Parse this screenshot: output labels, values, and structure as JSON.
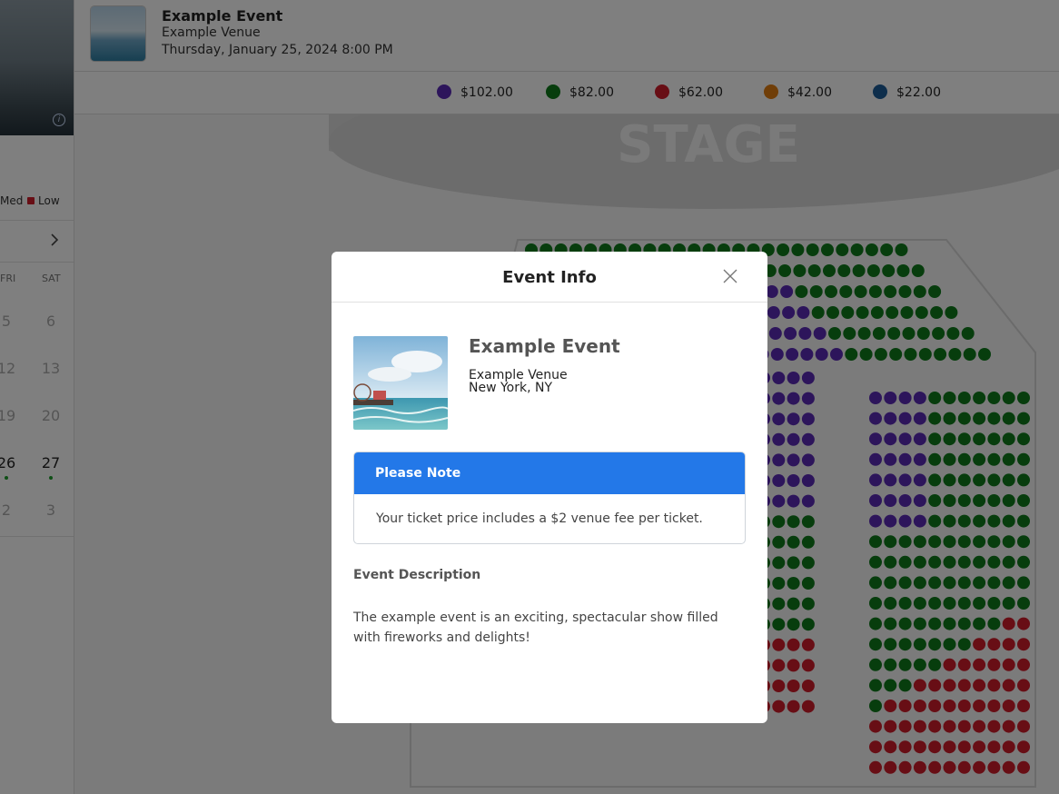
{
  "left_panel": {
    "legend": {
      "med_label": "Med",
      "low_label": "Low",
      "low_color": "#d01c2a"
    },
    "next_icon": "chevron-right-icon",
    "weekday_headers": [
      "FRI",
      "SAT"
    ],
    "weeks": [
      [
        "5",
        "6"
      ],
      [
        "12",
        "13"
      ],
      [
        "19",
        "20"
      ],
      [
        "26",
        "27"
      ],
      [
        "2",
        "3"
      ]
    ]
  },
  "header": {
    "event_title": "Example Event",
    "venue": "Example Venue",
    "date": "Thursday, January 25, 2024 8:00 PM"
  },
  "price_levels": [
    {
      "label": "$102.00",
      "color": "#5b2bb7"
    },
    {
      "label": "$82.00",
      "color": "#0e7a1b"
    },
    {
      "label": "$62.00",
      "color": "#d01c2a"
    },
    {
      "label": "$42.00",
      "color": "#e07d10"
    },
    {
      "label": "$22.00",
      "color": "#1c5d99"
    }
  ],
  "seat_map": {
    "stage_label": "STAGE"
  },
  "modal": {
    "title": "Event Info",
    "close_icon": "close-icon",
    "event_title": "Example Event",
    "venue": "Example Venue",
    "location": "New York, NY",
    "note_heading": "Please Note",
    "note_text": "Your ticket price includes a $2 venue fee per ticket.",
    "description_heading": "Event Description",
    "description": "The example event is an exciting, spectacular show filled with fireworks and delights!"
  }
}
